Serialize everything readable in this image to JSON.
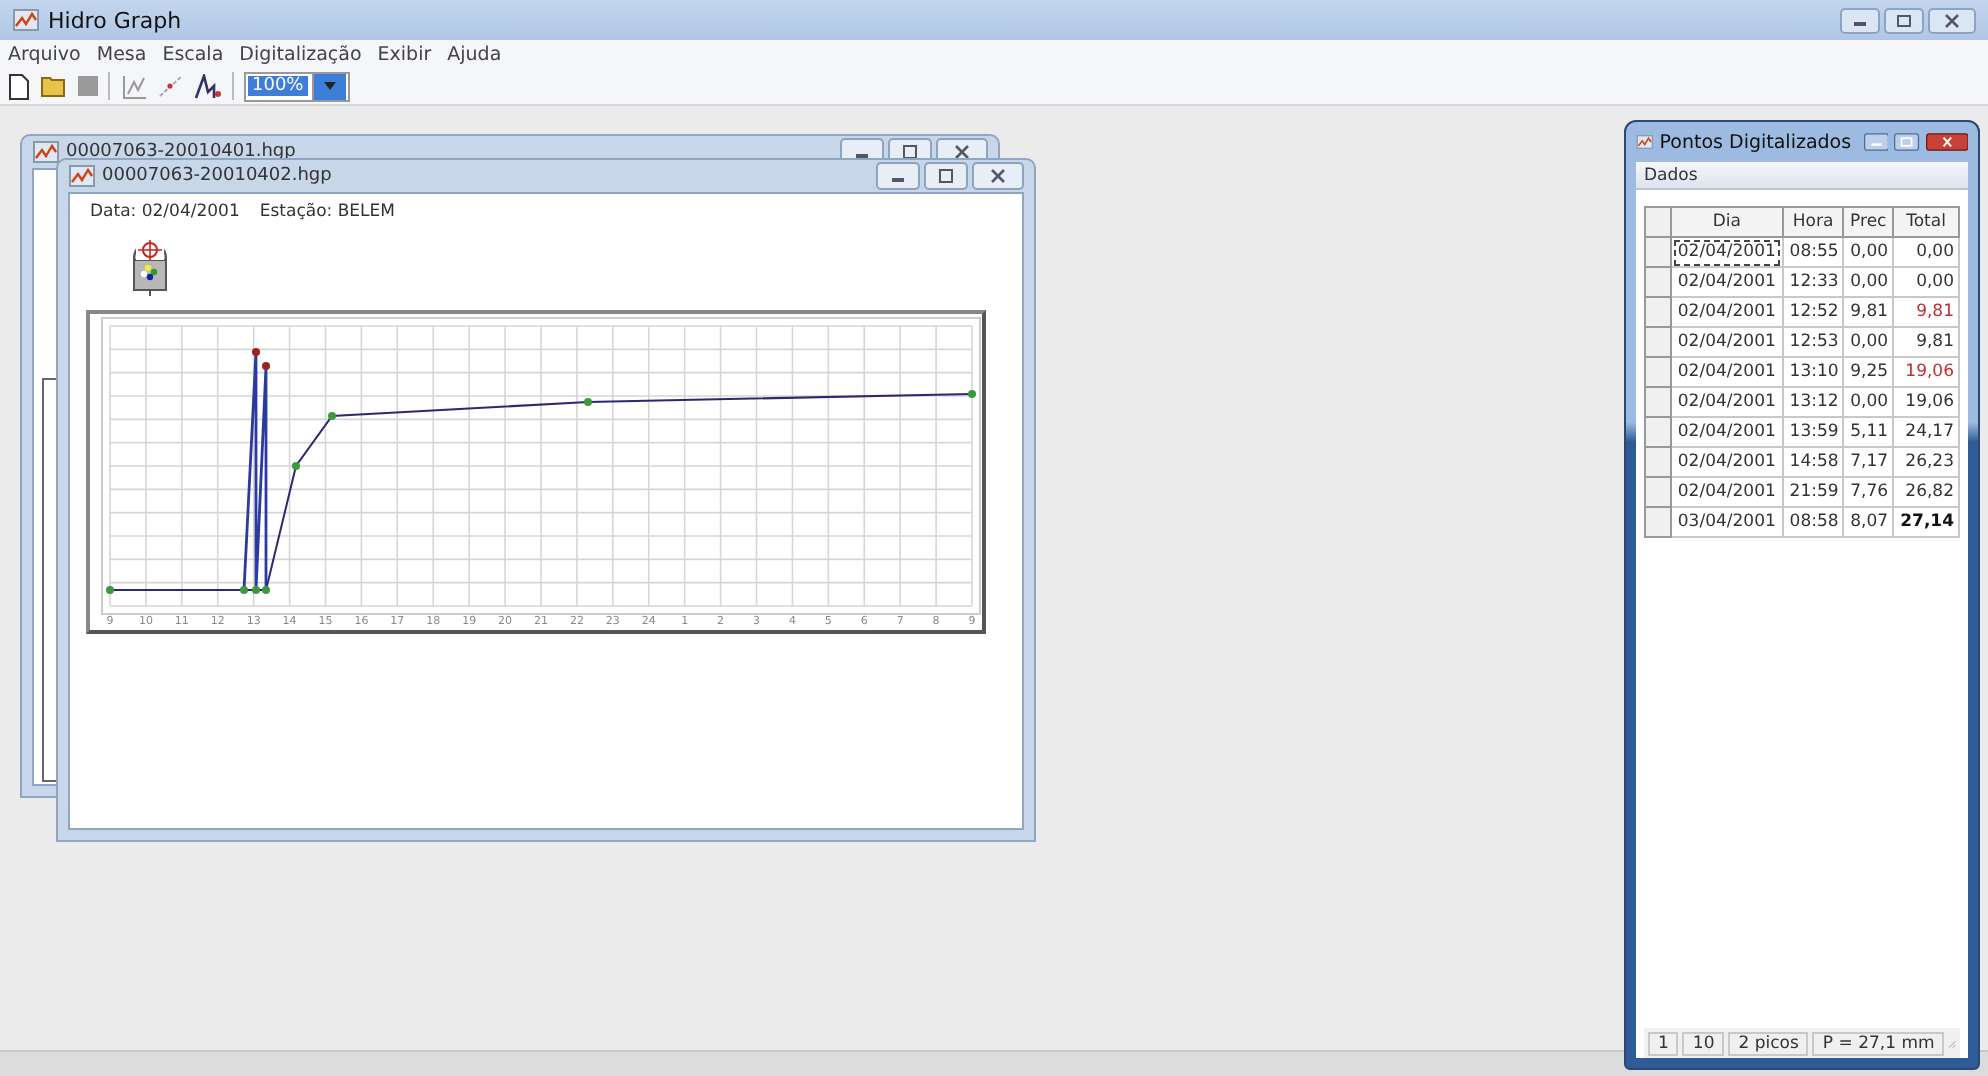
{
  "window": {
    "title": "Hidro Graph"
  },
  "menu": [
    "Arquivo",
    "Mesa",
    "Escala",
    "Digitalização",
    "Exibir",
    "Ajuda"
  ],
  "toolbar": {
    "zoom": "100%"
  },
  "documents": [
    {
      "title": "00007063-20010401.hgp"
    },
    {
      "title": "00007063-20010402.hgp",
      "date": "Data: 02/04/2001",
      "station": "Estação: BELEM",
      "x_labels": [
        "9",
        "10",
        "11",
        "12",
        "13",
        "14",
        "15",
        "16",
        "17",
        "18",
        "19",
        "20",
        "21",
        "22",
        "23",
        "24",
        "1",
        "2",
        "3",
        "4",
        "5",
        "6",
        "7",
        "8",
        "9"
      ]
    }
  ],
  "points_window": {
    "title": "Pontos Digitalizados",
    "menu": [
      "Dados"
    ],
    "columns": [
      "Dia",
      "Hora",
      "Prec",
      "Total"
    ],
    "rows": [
      {
        "dia": "02/04/2001",
        "hora": "08:55",
        "prec": "0,00",
        "total": "0,00",
        "kind": "normal",
        "focused": true
      },
      {
        "dia": "02/04/2001",
        "hora": "12:33",
        "prec": "0,00",
        "total": "0,00",
        "kind": "normal",
        "focused": false
      },
      {
        "dia": "02/04/2001",
        "hora": "12:52",
        "prec": "9,81",
        "total": "9,81",
        "kind": "peak",
        "focused": false
      },
      {
        "dia": "02/04/2001",
        "hora": "12:53",
        "prec": "0,00",
        "total": "9,81",
        "kind": "normal",
        "focused": false
      },
      {
        "dia": "02/04/2001",
        "hora": "13:10",
        "prec": "9,25",
        "total": "19,06",
        "kind": "peak",
        "focused": false
      },
      {
        "dia": "02/04/2001",
        "hora": "13:12",
        "prec": "0,00",
        "total": "19,06",
        "kind": "normal",
        "focused": false
      },
      {
        "dia": "02/04/2001",
        "hora": "13:59",
        "prec": "5,11",
        "total": "24,17",
        "kind": "normal",
        "focused": false
      },
      {
        "dia": "02/04/2001",
        "hora": "14:58",
        "prec": "7,17",
        "total": "26,23",
        "kind": "normal",
        "focused": false
      },
      {
        "dia": "02/04/2001",
        "hora": "21:59",
        "prec": "7,76",
        "total": "26,82",
        "kind": "normal",
        "focused": false
      },
      {
        "dia": "03/04/2001",
        "hora": "08:58",
        "prec": "8,07",
        "total": "27,14",
        "kind": "final",
        "focused": false
      }
    ],
    "status": [
      "1",
      "10",
      "2 picos",
      "P = 27,1 mm"
    ]
  }
}
